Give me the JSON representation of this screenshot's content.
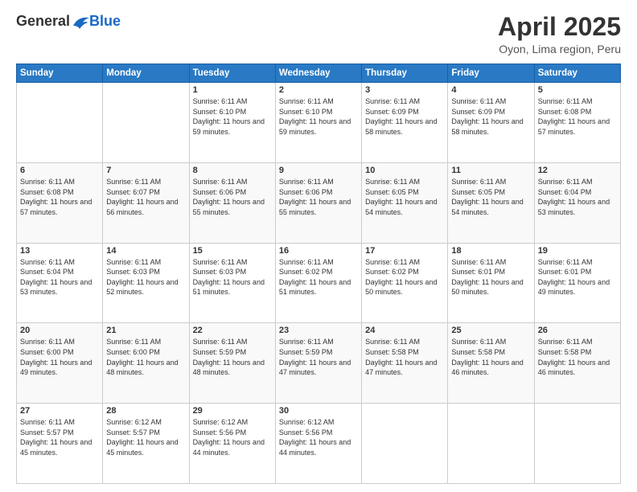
{
  "logo": {
    "general": "General",
    "blue": "Blue"
  },
  "title": "April 2025",
  "subtitle": "Oyon, Lima region, Peru",
  "days_of_week": [
    "Sunday",
    "Monday",
    "Tuesday",
    "Wednesday",
    "Thursday",
    "Friday",
    "Saturday"
  ],
  "weeks": [
    [
      {
        "day": "",
        "info": ""
      },
      {
        "day": "",
        "info": ""
      },
      {
        "day": "1",
        "sunrise": "Sunrise: 6:11 AM",
        "sunset": "Sunset: 6:10 PM",
        "daylight": "Daylight: 11 hours and 59 minutes."
      },
      {
        "day": "2",
        "sunrise": "Sunrise: 6:11 AM",
        "sunset": "Sunset: 6:10 PM",
        "daylight": "Daylight: 11 hours and 59 minutes."
      },
      {
        "day": "3",
        "sunrise": "Sunrise: 6:11 AM",
        "sunset": "Sunset: 6:09 PM",
        "daylight": "Daylight: 11 hours and 58 minutes."
      },
      {
        "day": "4",
        "sunrise": "Sunrise: 6:11 AM",
        "sunset": "Sunset: 6:09 PM",
        "daylight": "Daylight: 11 hours and 58 minutes."
      },
      {
        "day": "5",
        "sunrise": "Sunrise: 6:11 AM",
        "sunset": "Sunset: 6:08 PM",
        "daylight": "Daylight: 11 hours and 57 minutes."
      }
    ],
    [
      {
        "day": "6",
        "sunrise": "Sunrise: 6:11 AM",
        "sunset": "Sunset: 6:08 PM",
        "daylight": "Daylight: 11 hours and 57 minutes."
      },
      {
        "day": "7",
        "sunrise": "Sunrise: 6:11 AM",
        "sunset": "Sunset: 6:07 PM",
        "daylight": "Daylight: 11 hours and 56 minutes."
      },
      {
        "day": "8",
        "sunrise": "Sunrise: 6:11 AM",
        "sunset": "Sunset: 6:06 PM",
        "daylight": "Daylight: 11 hours and 55 minutes."
      },
      {
        "day": "9",
        "sunrise": "Sunrise: 6:11 AM",
        "sunset": "Sunset: 6:06 PM",
        "daylight": "Daylight: 11 hours and 55 minutes."
      },
      {
        "day": "10",
        "sunrise": "Sunrise: 6:11 AM",
        "sunset": "Sunset: 6:05 PM",
        "daylight": "Daylight: 11 hours and 54 minutes."
      },
      {
        "day": "11",
        "sunrise": "Sunrise: 6:11 AM",
        "sunset": "Sunset: 6:05 PM",
        "daylight": "Daylight: 11 hours and 54 minutes."
      },
      {
        "day": "12",
        "sunrise": "Sunrise: 6:11 AM",
        "sunset": "Sunset: 6:04 PM",
        "daylight": "Daylight: 11 hours and 53 minutes."
      }
    ],
    [
      {
        "day": "13",
        "sunrise": "Sunrise: 6:11 AM",
        "sunset": "Sunset: 6:04 PM",
        "daylight": "Daylight: 11 hours and 53 minutes."
      },
      {
        "day": "14",
        "sunrise": "Sunrise: 6:11 AM",
        "sunset": "Sunset: 6:03 PM",
        "daylight": "Daylight: 11 hours and 52 minutes."
      },
      {
        "day": "15",
        "sunrise": "Sunrise: 6:11 AM",
        "sunset": "Sunset: 6:03 PM",
        "daylight": "Daylight: 11 hours and 51 minutes."
      },
      {
        "day": "16",
        "sunrise": "Sunrise: 6:11 AM",
        "sunset": "Sunset: 6:02 PM",
        "daylight": "Daylight: 11 hours and 51 minutes."
      },
      {
        "day": "17",
        "sunrise": "Sunrise: 6:11 AM",
        "sunset": "Sunset: 6:02 PM",
        "daylight": "Daylight: 11 hours and 50 minutes."
      },
      {
        "day": "18",
        "sunrise": "Sunrise: 6:11 AM",
        "sunset": "Sunset: 6:01 PM",
        "daylight": "Daylight: 11 hours and 50 minutes."
      },
      {
        "day": "19",
        "sunrise": "Sunrise: 6:11 AM",
        "sunset": "Sunset: 6:01 PM",
        "daylight": "Daylight: 11 hours and 49 minutes."
      }
    ],
    [
      {
        "day": "20",
        "sunrise": "Sunrise: 6:11 AM",
        "sunset": "Sunset: 6:00 PM",
        "daylight": "Daylight: 11 hours and 49 minutes."
      },
      {
        "day": "21",
        "sunrise": "Sunrise: 6:11 AM",
        "sunset": "Sunset: 6:00 PM",
        "daylight": "Daylight: 11 hours and 48 minutes."
      },
      {
        "day": "22",
        "sunrise": "Sunrise: 6:11 AM",
        "sunset": "Sunset: 5:59 PM",
        "daylight": "Daylight: 11 hours and 48 minutes."
      },
      {
        "day": "23",
        "sunrise": "Sunrise: 6:11 AM",
        "sunset": "Sunset: 5:59 PM",
        "daylight": "Daylight: 11 hours and 47 minutes."
      },
      {
        "day": "24",
        "sunrise": "Sunrise: 6:11 AM",
        "sunset": "Sunset: 5:58 PM",
        "daylight": "Daylight: 11 hours and 47 minutes."
      },
      {
        "day": "25",
        "sunrise": "Sunrise: 6:11 AM",
        "sunset": "Sunset: 5:58 PM",
        "daylight": "Daylight: 11 hours and 46 minutes."
      },
      {
        "day": "26",
        "sunrise": "Sunrise: 6:11 AM",
        "sunset": "Sunset: 5:58 PM",
        "daylight": "Daylight: 11 hours and 46 minutes."
      }
    ],
    [
      {
        "day": "27",
        "sunrise": "Sunrise: 6:11 AM",
        "sunset": "Sunset: 5:57 PM",
        "daylight": "Daylight: 11 hours and 45 minutes."
      },
      {
        "day": "28",
        "sunrise": "Sunrise: 6:12 AM",
        "sunset": "Sunset: 5:57 PM",
        "daylight": "Daylight: 11 hours and 45 minutes."
      },
      {
        "day": "29",
        "sunrise": "Sunrise: 6:12 AM",
        "sunset": "Sunset: 5:56 PM",
        "daylight": "Daylight: 11 hours and 44 minutes."
      },
      {
        "day": "30",
        "sunrise": "Sunrise: 6:12 AM",
        "sunset": "Sunset: 5:56 PM",
        "daylight": "Daylight: 11 hours and 44 minutes."
      },
      {
        "day": "",
        "info": ""
      },
      {
        "day": "",
        "info": ""
      },
      {
        "day": "",
        "info": ""
      }
    ]
  ]
}
